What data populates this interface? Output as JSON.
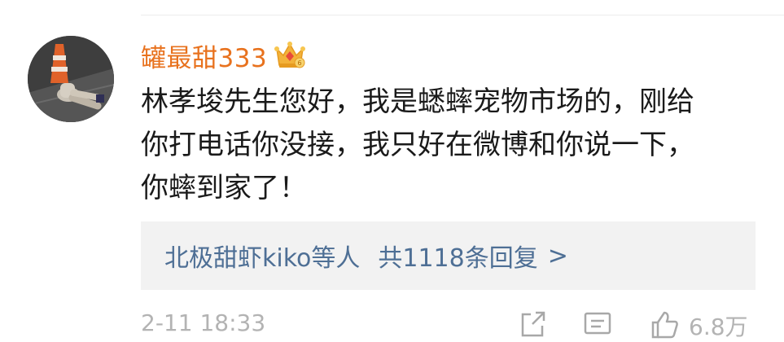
{
  "comment": {
    "username": "罐最甜333",
    "badge_icon": "crown-badge-icon",
    "avatar_icon": "traffic-cone-avatar",
    "text_lines": [
      "林孝埈先生您好，我是蟋蟀宠物市场的，刚给",
      "你打电话你没接，我只好在微博和你说一下，",
      "你蟀到家了！"
    ],
    "replies": {
      "users": "北极甜虾kiko等人",
      "count_label": "共1118条回复",
      "chevron": ">"
    },
    "footer": {
      "timestamp": "2-11 18:33",
      "share_icon": "share-icon",
      "comment_icon": "comment-icon",
      "like_icon": "thumbs-up-icon",
      "like_count": "6.8万"
    }
  },
  "colors": {
    "username": "#e8721e",
    "text": "#1a1a1a",
    "link": "#4e6f95",
    "muted": "#b3b3b3",
    "reply_bg": "#f2f2f2"
  }
}
